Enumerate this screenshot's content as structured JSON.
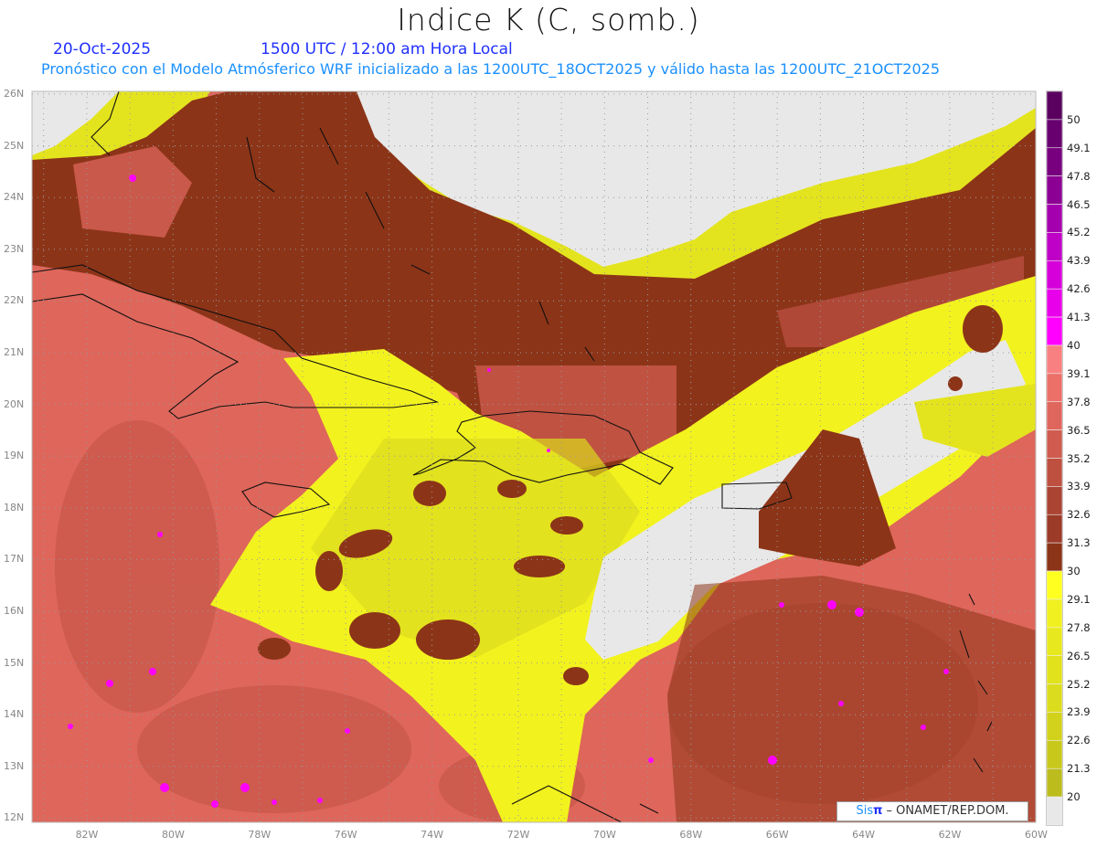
{
  "header": {
    "title": "Indice K (C, somb.)",
    "date": "20-Oct-2025",
    "time": "1500 UTC / 12:00 am Hora Local",
    "description": "Pronóstico con el Modelo Atmósferico WRF inicializado a las 1200UTC_18OCT2025 y válido hasta las  1200UTC_21OCT2025"
  },
  "axes": {
    "lat_labels": [
      "26N",
      "25N",
      "24N",
      "23N",
      "22N",
      "21N",
      "20N",
      "19N",
      "18N",
      "17N",
      "16N",
      "15N",
      "14N",
      "13N",
      "12N"
    ],
    "lon_labels": [
      "82W",
      "80W",
      "78W",
      "76W",
      "74W",
      "72W",
      "70W",
      "68W",
      "66W",
      "64W",
      "62W",
      "60W"
    ]
  },
  "colorbar": {
    "labels": [
      "50",
      "49.1",
      "47.8",
      "46.5",
      "45.2",
      "43.9",
      "42.6",
      "41.3",
      "40",
      "39.1",
      "37.8",
      "36.5",
      "35.2",
      "33.9",
      "32.6",
      "31.3",
      "30",
      "29.1",
      "27.8",
      "26.5",
      "25.2",
      "23.9",
      "22.6",
      "21.3",
      "20"
    ],
    "colors": [
      "#5a005e",
      "#680070",
      "#78007f",
      "#8d0094",
      "#a500ad",
      "#bf00c6",
      "#d600da",
      "#e800ea",
      "#ff00ff",
      "#f98080",
      "#ec7068",
      "#df665c",
      "#cf5c4e",
      "#be5040",
      "#ac4434",
      "#9c3b28",
      "#8c3418",
      "#ffff20",
      "#f0f020",
      "#e8e81e",
      "#e2e21c",
      "#dcdc1e",
      "#d2d21c",
      "#c8c81c",
      "#bcbc1e",
      "#e8e8e8"
    ]
  },
  "credit": {
    "sis": "Sis",
    "pi": "π",
    "org": " –  ONAMET/REP.DOM."
  }
}
